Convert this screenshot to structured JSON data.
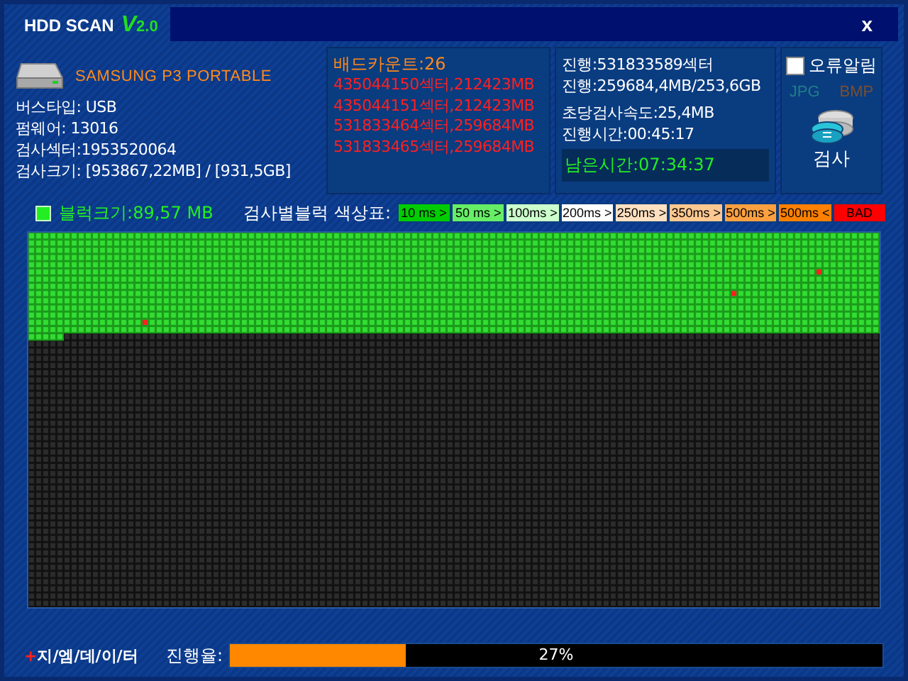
{
  "window": {
    "title": "HDD SCAN",
    "version_mark": "V",
    "version": "2.0",
    "close": "x"
  },
  "drive": {
    "name": "SAMSUNG P3 PORTABLE",
    "info": [
      "버스타입: USB",
      "펌웨어: 13016",
      "검사섹터:1953520064",
      "검사크기: [953867,22MB] / [931,5GB]"
    ]
  },
  "bad": {
    "title": "배드카운트:26",
    "entries": [
      "435044150섹터,212423MB",
      "435044151섹터,212423MB",
      "531833464섹터,259684MB",
      "531833465섹터,259684MB"
    ]
  },
  "progress_info": [
    "진행:531833589섹터",
    "진행:259684,4MB/253,6GB",
    "초당검사속도:25,4MB",
    "진행시간:00:45:17"
  ],
  "remaining": "남은시간:07:34:37",
  "options": {
    "error_alert": {
      "label": "오류알림",
      "checked": false
    },
    "formats": [
      {
        "label": "JPG",
        "color": "#1f7f86"
      },
      {
        "label": "BMP",
        "color": "#7a4f2e"
      }
    ],
    "scan_button": "검사"
  },
  "block_size": "블럭크기:89,57 MB",
  "legend": {
    "title": "검사별블럭 색상표:",
    "items": [
      {
        "label": "10 ms >",
        "color": "#00cc00"
      },
      {
        "label": "50 ms >",
        "color": "#66ee66"
      },
      {
        "label": "100ms >",
        "color": "#ccffcc"
      },
      {
        "label": "200ms >",
        "color": "#ffffff"
      },
      {
        "label": "250ms >",
        "color": "#ffe0c0"
      },
      {
        "label": "350ms >",
        "color": "#ffc890"
      },
      {
        "label": "500ms >",
        "color": "#ffa040"
      },
      {
        "label": "500ms <",
        "color": "#ff8000"
      },
      {
        "label": "BAD",
        "color": "#ff0000"
      }
    ]
  },
  "footer": {
    "brand_mark": "+",
    "brand": "지/엠/데/이/터",
    "progress_label": "진행율:",
    "progress": {
      "level": 0.27,
      "text": "27%"
    }
  }
}
